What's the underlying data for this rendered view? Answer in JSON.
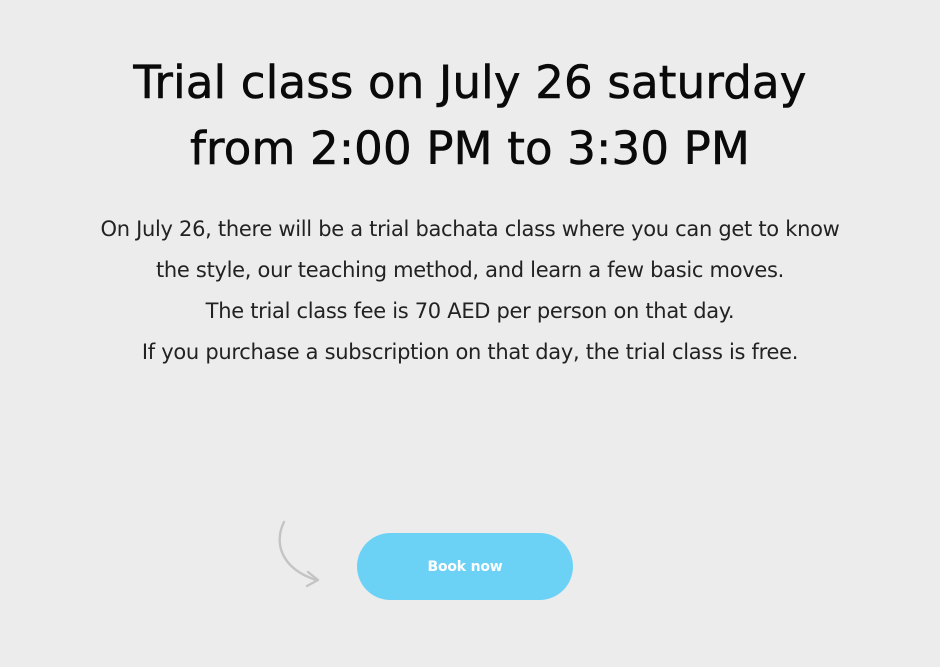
{
  "headline": {
    "line1": "Trial class on July 26 saturday",
    "line2": "from 2:00 PM to 3:30 PM"
  },
  "description": {
    "paragraph1": "On July 26, there will be a trial bachata class where you can get to know the style, our teaching method, and learn a few basic moves.",
    "paragraph2": "The trial class fee is 70 AED per person on that day.",
    "paragraph3": "If you purchase a subscription on that day, the trial class is free."
  },
  "cta": {
    "label": "Book now",
    "color": "#6bd2f6",
    "icon": "curved-arrow-icon"
  },
  "theme": {
    "background": "#ececec",
    "text": "#111111"
  }
}
